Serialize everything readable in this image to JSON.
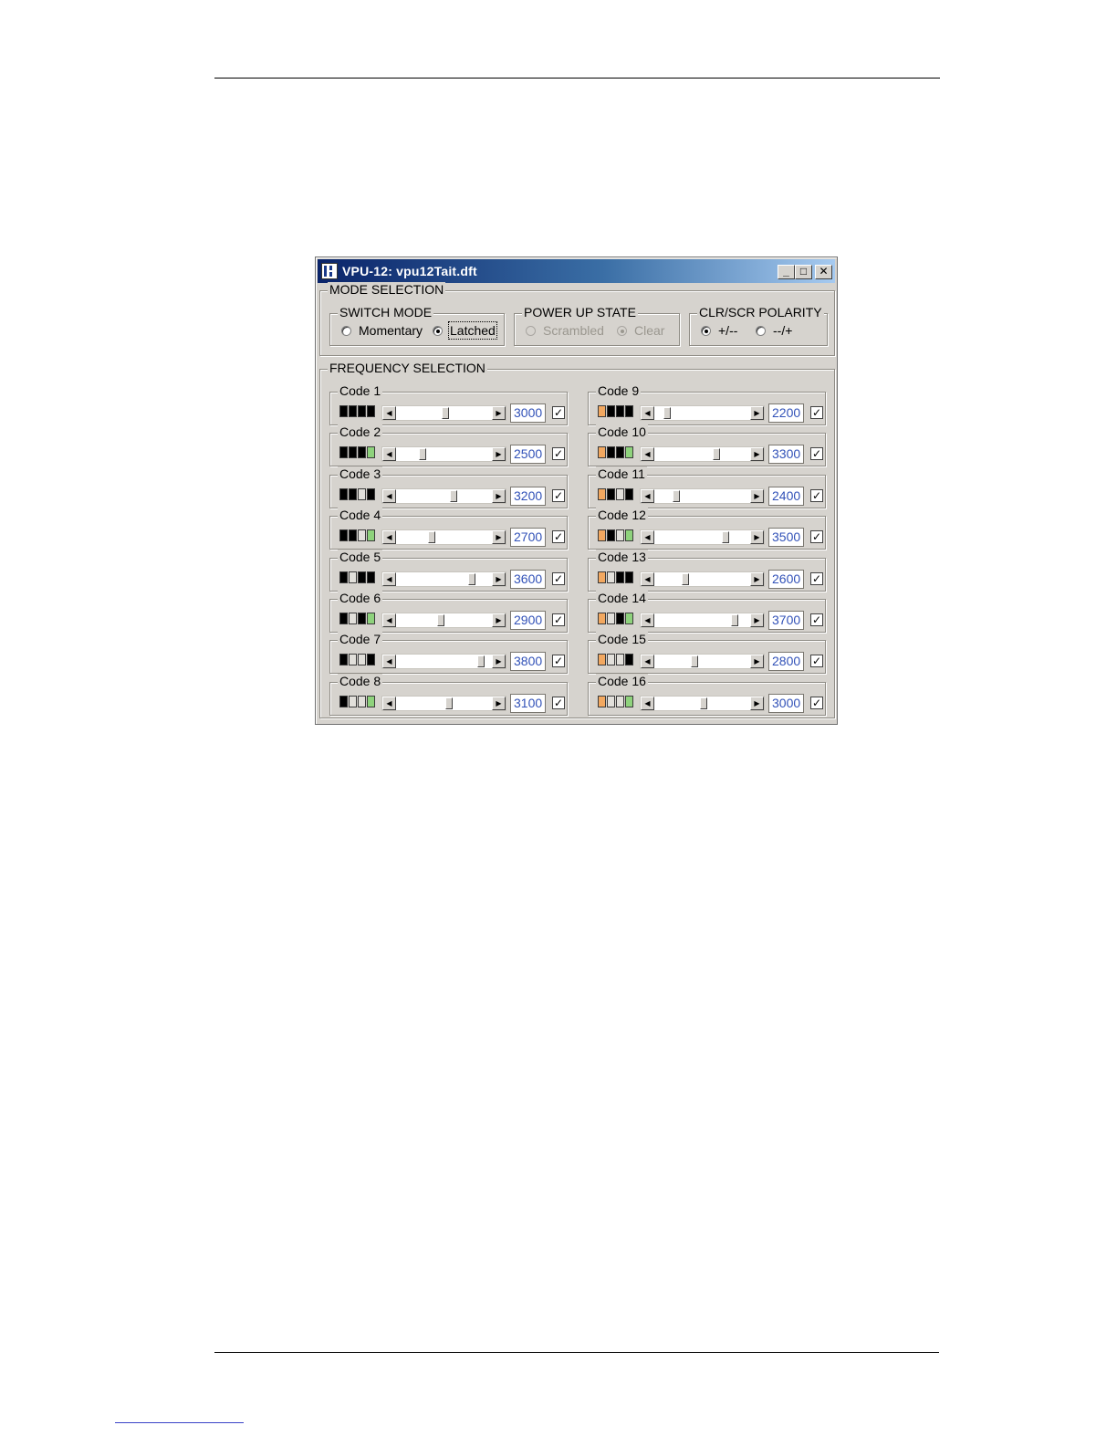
{
  "window": {
    "title": "VPU-12: vpu12Tait.dft",
    "minimize_glyph": "_",
    "maximize_glyph": "□",
    "close_glyph": "✕"
  },
  "mode_selection": {
    "label": "MODE SELECTION",
    "switch_mode": {
      "label": "SWITCH MODE",
      "options": [
        "Momentary",
        "Latched"
      ],
      "selected": "Latched"
    },
    "power_up_state": {
      "label": "POWER UP STATE",
      "options": [
        "Scrambled",
        "Clear"
      ],
      "selected": "Clear",
      "disabled": true
    },
    "clr_scr_polarity": {
      "label": "CLR/SCR POLARITY",
      "options": [
        "+/--",
        "--/+"
      ],
      "selected": "+/--"
    }
  },
  "frequency_selection": {
    "label": "FREQUENCY SELECTION",
    "colors": {
      "B": "#000000",
      "W": "#e2e0db",
      "G": "#8ed27c",
      "O": "#f2a860"
    },
    "slider_min": 2000,
    "slider_max": 4000,
    "codes": [
      {
        "label": "Code 1",
        "value": "3000",
        "checked": true,
        "swatches": [
          "B",
          "B",
          "B",
          "B"
        ]
      },
      {
        "label": "Code 2",
        "value": "2500",
        "checked": true,
        "swatches": [
          "B",
          "B",
          "B",
          "G"
        ]
      },
      {
        "label": "Code 3",
        "value": "3200",
        "checked": true,
        "swatches": [
          "B",
          "B",
          "W",
          "B"
        ]
      },
      {
        "label": "Code 4",
        "value": "2700",
        "checked": true,
        "swatches": [
          "B",
          "B",
          "W",
          "G"
        ]
      },
      {
        "label": "Code 5",
        "value": "3600",
        "checked": true,
        "swatches": [
          "B",
          "W",
          "B",
          "B"
        ]
      },
      {
        "label": "Code 6",
        "value": "2900",
        "checked": true,
        "swatches": [
          "B",
          "W",
          "B",
          "G"
        ]
      },
      {
        "label": "Code 7",
        "value": "3800",
        "checked": true,
        "swatches": [
          "B",
          "W",
          "W",
          "B"
        ]
      },
      {
        "label": "Code 8",
        "value": "3100",
        "checked": true,
        "swatches": [
          "B",
          "W",
          "W",
          "G"
        ]
      },
      {
        "label": "Code 9",
        "value": "2200",
        "checked": true,
        "swatches": [
          "O",
          "B",
          "B",
          "B"
        ]
      },
      {
        "label": "Code 10",
        "value": "3300",
        "checked": true,
        "swatches": [
          "O",
          "B",
          "B",
          "G"
        ]
      },
      {
        "label": "Code 11",
        "value": "2400",
        "checked": true,
        "swatches": [
          "O",
          "B",
          "W",
          "B"
        ]
      },
      {
        "label": "Code 12",
        "value": "3500",
        "checked": true,
        "swatches": [
          "O",
          "B",
          "W",
          "G"
        ]
      },
      {
        "label": "Code 13",
        "value": "2600",
        "checked": true,
        "swatches": [
          "O",
          "W",
          "B",
          "B"
        ]
      },
      {
        "label": "Code 14",
        "value": "3700",
        "checked": true,
        "swatches": [
          "O",
          "W",
          "B",
          "G"
        ]
      },
      {
        "label": "Code 15",
        "value": "2800",
        "checked": true,
        "swatches": [
          "O",
          "W",
          "W",
          "B"
        ]
      },
      {
        "label": "Code 16",
        "value": "3000",
        "checked": true,
        "swatches": [
          "O",
          "W",
          "W",
          "G"
        ]
      }
    ]
  }
}
